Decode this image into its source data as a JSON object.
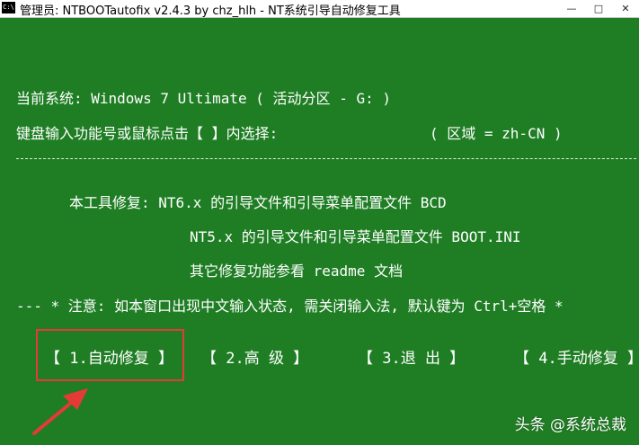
{
  "window": {
    "icon_label": "C:\\",
    "title": "管理员: NTBOOTautofix v2.4.3 by chz_hlh - NT系统引导自动修复工具",
    "controls": {
      "minimize": "—",
      "maximize": "□",
      "close": "✕"
    }
  },
  "console": {
    "current_system": "当前系统: Windows 7 Ultimate  ( 活动分区 - G: )",
    "prompt": "键盘输入功能号或鼠标点击【 】内选择:",
    "region": "( 区域 = zh-CN )",
    "separator": "------------------------------------------------------------------------------------------------",
    "repair_line_1": "本工具修复:   NT6.x 的引导文件和引导菜单配置文件 BCD",
    "repair_line_2": "NT5.x 的引导文件和引导菜单配置文件 BOOT.INI",
    "repair_line_3": "其它修复功能参看 readme 文档",
    "note": "--- * 注意: 如本窗口出现中文输入状态, 需关闭输入法, 默认键为 Ctrl+空格 *"
  },
  "menu": {
    "auto_repair": "【 1.自动修复 】",
    "advanced": "【  2.高  级  】",
    "exit": "【  3.退  出  】",
    "manual_repair": "【 4.手动修复 】"
  },
  "watermark": "头条 @系统总裁",
  "colors": {
    "background": "#1f7e24",
    "highlight": "#e53a35",
    "text": "#ffffff"
  }
}
